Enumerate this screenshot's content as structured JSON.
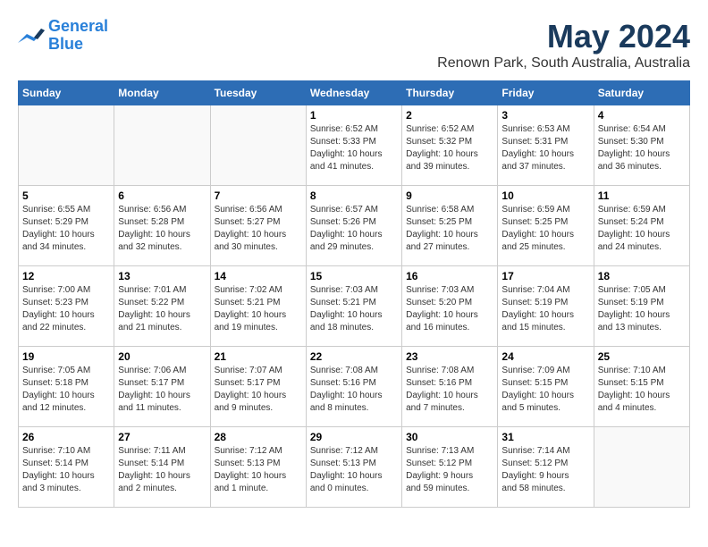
{
  "logo": {
    "line1": "General",
    "line2": "Blue"
  },
  "title": "May 2024",
  "location": "Renown Park, South Australia, Australia",
  "days_of_week": [
    "Sunday",
    "Monday",
    "Tuesday",
    "Wednesday",
    "Thursday",
    "Friday",
    "Saturday"
  ],
  "weeks": [
    [
      {
        "day": "",
        "info": ""
      },
      {
        "day": "",
        "info": ""
      },
      {
        "day": "",
        "info": ""
      },
      {
        "day": "1",
        "info": "Sunrise: 6:52 AM\nSunset: 5:33 PM\nDaylight: 10 hours\nand 41 minutes."
      },
      {
        "day": "2",
        "info": "Sunrise: 6:52 AM\nSunset: 5:32 PM\nDaylight: 10 hours\nand 39 minutes."
      },
      {
        "day": "3",
        "info": "Sunrise: 6:53 AM\nSunset: 5:31 PM\nDaylight: 10 hours\nand 37 minutes."
      },
      {
        "day": "4",
        "info": "Sunrise: 6:54 AM\nSunset: 5:30 PM\nDaylight: 10 hours\nand 36 minutes."
      }
    ],
    [
      {
        "day": "5",
        "info": "Sunrise: 6:55 AM\nSunset: 5:29 PM\nDaylight: 10 hours\nand 34 minutes."
      },
      {
        "day": "6",
        "info": "Sunrise: 6:56 AM\nSunset: 5:28 PM\nDaylight: 10 hours\nand 32 minutes."
      },
      {
        "day": "7",
        "info": "Sunrise: 6:56 AM\nSunset: 5:27 PM\nDaylight: 10 hours\nand 30 minutes."
      },
      {
        "day": "8",
        "info": "Sunrise: 6:57 AM\nSunset: 5:26 PM\nDaylight: 10 hours\nand 29 minutes."
      },
      {
        "day": "9",
        "info": "Sunrise: 6:58 AM\nSunset: 5:25 PM\nDaylight: 10 hours\nand 27 minutes."
      },
      {
        "day": "10",
        "info": "Sunrise: 6:59 AM\nSunset: 5:25 PM\nDaylight: 10 hours\nand 25 minutes."
      },
      {
        "day": "11",
        "info": "Sunrise: 6:59 AM\nSunset: 5:24 PM\nDaylight: 10 hours\nand 24 minutes."
      }
    ],
    [
      {
        "day": "12",
        "info": "Sunrise: 7:00 AM\nSunset: 5:23 PM\nDaylight: 10 hours\nand 22 minutes."
      },
      {
        "day": "13",
        "info": "Sunrise: 7:01 AM\nSunset: 5:22 PM\nDaylight: 10 hours\nand 21 minutes."
      },
      {
        "day": "14",
        "info": "Sunrise: 7:02 AM\nSunset: 5:21 PM\nDaylight: 10 hours\nand 19 minutes."
      },
      {
        "day": "15",
        "info": "Sunrise: 7:03 AM\nSunset: 5:21 PM\nDaylight: 10 hours\nand 18 minutes."
      },
      {
        "day": "16",
        "info": "Sunrise: 7:03 AM\nSunset: 5:20 PM\nDaylight: 10 hours\nand 16 minutes."
      },
      {
        "day": "17",
        "info": "Sunrise: 7:04 AM\nSunset: 5:19 PM\nDaylight: 10 hours\nand 15 minutes."
      },
      {
        "day": "18",
        "info": "Sunrise: 7:05 AM\nSunset: 5:19 PM\nDaylight: 10 hours\nand 13 minutes."
      }
    ],
    [
      {
        "day": "19",
        "info": "Sunrise: 7:05 AM\nSunset: 5:18 PM\nDaylight: 10 hours\nand 12 minutes."
      },
      {
        "day": "20",
        "info": "Sunrise: 7:06 AM\nSunset: 5:17 PM\nDaylight: 10 hours\nand 11 minutes."
      },
      {
        "day": "21",
        "info": "Sunrise: 7:07 AM\nSunset: 5:17 PM\nDaylight: 10 hours\nand 9 minutes."
      },
      {
        "day": "22",
        "info": "Sunrise: 7:08 AM\nSunset: 5:16 PM\nDaylight: 10 hours\nand 8 minutes."
      },
      {
        "day": "23",
        "info": "Sunrise: 7:08 AM\nSunset: 5:16 PM\nDaylight: 10 hours\nand 7 minutes."
      },
      {
        "day": "24",
        "info": "Sunrise: 7:09 AM\nSunset: 5:15 PM\nDaylight: 10 hours\nand 5 minutes."
      },
      {
        "day": "25",
        "info": "Sunrise: 7:10 AM\nSunset: 5:15 PM\nDaylight: 10 hours\nand 4 minutes."
      }
    ],
    [
      {
        "day": "26",
        "info": "Sunrise: 7:10 AM\nSunset: 5:14 PM\nDaylight: 10 hours\nand 3 minutes."
      },
      {
        "day": "27",
        "info": "Sunrise: 7:11 AM\nSunset: 5:14 PM\nDaylight: 10 hours\nand 2 minutes."
      },
      {
        "day": "28",
        "info": "Sunrise: 7:12 AM\nSunset: 5:13 PM\nDaylight: 10 hours\nand 1 minute."
      },
      {
        "day": "29",
        "info": "Sunrise: 7:12 AM\nSunset: 5:13 PM\nDaylight: 10 hours\nand 0 minutes."
      },
      {
        "day": "30",
        "info": "Sunrise: 7:13 AM\nSunset: 5:12 PM\nDaylight: 9 hours\nand 59 minutes."
      },
      {
        "day": "31",
        "info": "Sunrise: 7:14 AM\nSunset: 5:12 PM\nDaylight: 9 hours\nand 58 minutes."
      },
      {
        "day": "",
        "info": ""
      }
    ]
  ]
}
